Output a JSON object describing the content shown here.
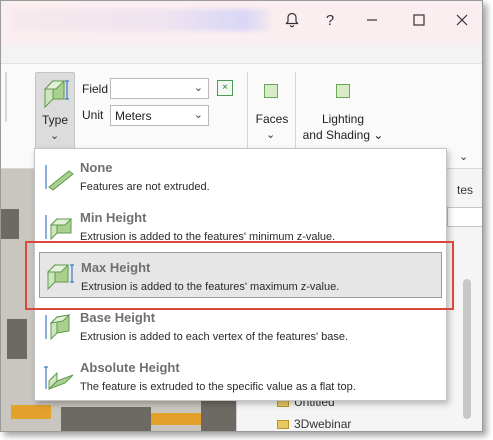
{
  "titlebar": {
    "notification_icon": "bell-icon",
    "help_label": "?",
    "minimize_icon": "minimize-icon",
    "maximize_icon": "maximize-icon",
    "close_icon": "close-icon"
  },
  "ribbon": {
    "type_button": {
      "label": "Type",
      "icon": "extrusion-max-height-icon"
    },
    "field": {
      "label": "Field",
      "value": ""
    },
    "unit": {
      "label": "Unit",
      "value": "Meters"
    },
    "expression_icon": "expression-builder-icon",
    "faces": {
      "label": "Faces"
    },
    "lighting": {
      "line1": "Lighting",
      "line2": "and Shading"
    }
  },
  "pane": {
    "tab_fragment": "tes",
    "tree": [
      {
        "label": "Untitled"
      },
      {
        "label": "3Dwebinar"
      }
    ]
  },
  "type_menu": {
    "items": [
      {
        "title": "None",
        "description": "Features are not extruded.",
        "icon": "extrusion-none-icon",
        "selected": false
      },
      {
        "title": "Min Height",
        "description": "Extrusion is added to the features' minimum z-value.",
        "icon": "extrusion-min-height-icon",
        "selected": false
      },
      {
        "title": "Max Height",
        "description": "Extrusion is added to the features' maximum z-value.",
        "icon": "extrusion-max-height-icon",
        "selected": true
      },
      {
        "title": "Base Height",
        "description": "Extrusion is added to each vertex of the features' base.",
        "icon": "extrusion-base-height-icon",
        "selected": false
      },
      {
        "title": "Absolute Height",
        "description": "The feature is extruded to the specific value as a flat top.",
        "icon": "extrusion-absolute-height-icon",
        "selected": false
      }
    ]
  },
  "colors": {
    "highlight_box": "#d8483c",
    "selected_item_bg": "#e6e6e6",
    "icon_green": "#6aa85a"
  }
}
